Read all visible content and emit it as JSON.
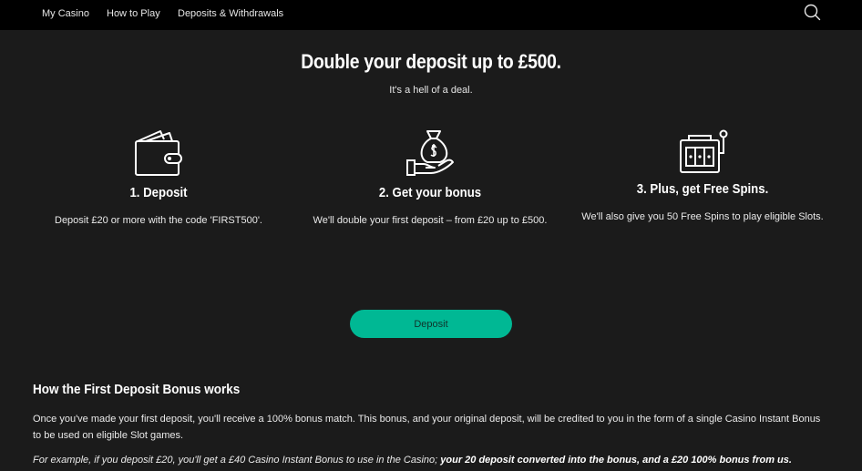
{
  "nav": {
    "items": [
      "My Casino",
      "How to Play",
      "Deposits & Withdrawals"
    ],
    "search_icon": "search-icon"
  },
  "hero": {
    "title": "Double your deposit up to £500.",
    "subtitle": "It's a hell of a deal."
  },
  "steps": [
    {
      "icon": "wallet-icon",
      "title": "1. Deposit",
      "description": "Deposit £20 or more with the code 'FIRST500'."
    },
    {
      "icon": "money-bag-hand-icon",
      "title": "2. Get your bonus",
      "description": "We'll double your first deposit – from £20 up to £500."
    },
    {
      "icon": "slot-machine-icon",
      "title": "3. Plus, get Free Spins.",
      "description": "We'll also give you 50 Free Spins to play eligible Slots."
    }
  ],
  "cta": {
    "label": "Deposit"
  },
  "colors": {
    "accent": "#00b894",
    "background": "#1b1b1b",
    "nav": "#000000"
  },
  "info": {
    "title": "How the First Deposit Bonus works",
    "paragraph1": "Once you've made your first deposit, you'll receive a 100% bonus match. This bonus, and your original deposit, will be credited to you in the form of a single Casino Instant Bonus to be used on eligible Slot games.",
    "example_italic": "For example, if you deposit £20, you'll get a £40 Casino Instant Bonus to use in the Casino;",
    "example_bold": "your 20 deposit converted into the bonus, and a £20 100% bonus from us."
  }
}
